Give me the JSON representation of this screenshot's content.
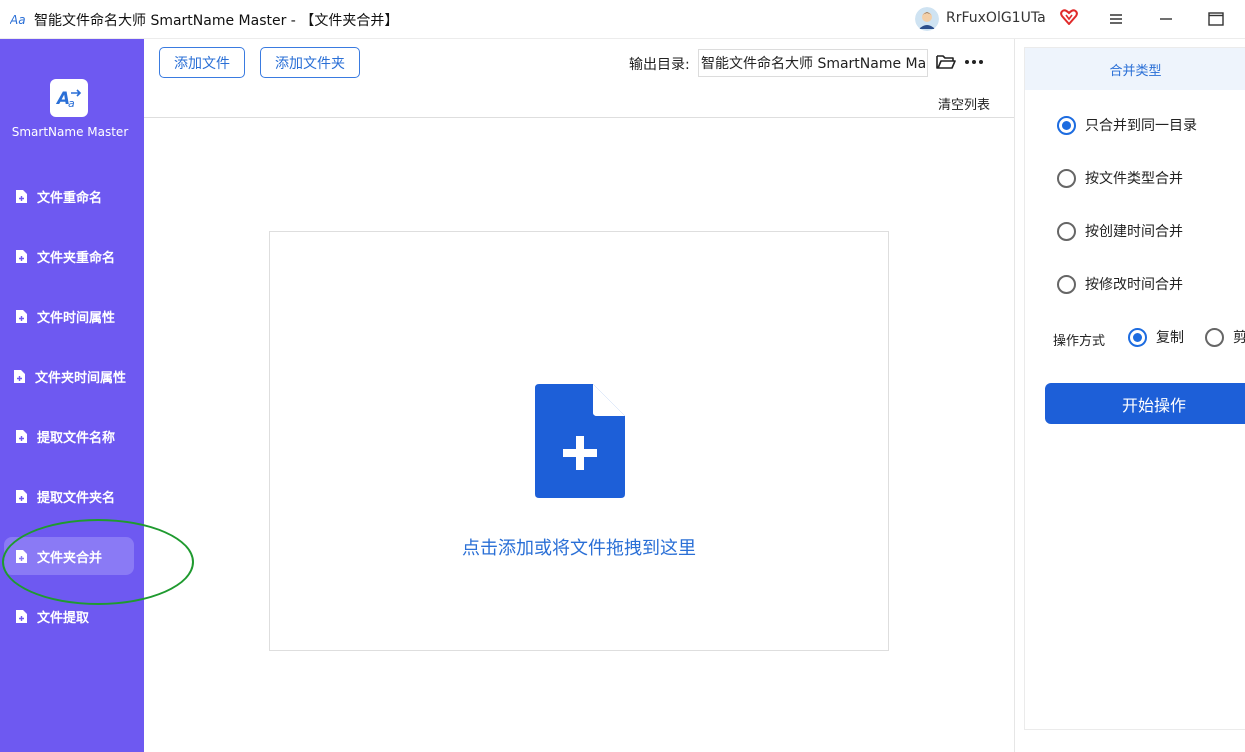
{
  "titlebar": {
    "title": "智能文件命名大师 SmartName Master - 【文件夹合并】",
    "user_name": "RrFuxOlG1UTa"
  },
  "sidebar": {
    "logo_text": "SmartName Master",
    "items": [
      {
        "label": "文件重命名"
      },
      {
        "label": "文件夹重命名"
      },
      {
        "label": "文件时间属性"
      },
      {
        "label": "文件夹时间属性"
      },
      {
        "label": "提取文件名称"
      },
      {
        "label": "提取文件夹名"
      },
      {
        "label": "文件夹合并"
      },
      {
        "label": "文件提取"
      }
    ],
    "active_index": 6
  },
  "toolbar": {
    "add_file_label": "添加文件",
    "add_folder_label": "添加文件夹",
    "output_label": "输出目录:",
    "output_value": "智能文件命名大师 SmartName Master",
    "clear_list_label": "清空列表"
  },
  "dropzone": {
    "hint": "点击添加或将文件拖拽到这里"
  },
  "right_panel": {
    "header": "合并类型",
    "merge_options": [
      {
        "label": "只合并到同一目录",
        "selected": true
      },
      {
        "label": "按文件类型合并",
        "selected": false
      },
      {
        "label": "按创建时间合并",
        "selected": false
      },
      {
        "label": "按修改时间合并",
        "selected": false
      }
    ],
    "operation_label": "操作方式",
    "operation_options": [
      {
        "label": "复制",
        "selected": true
      },
      {
        "label": "剪",
        "selected": false
      }
    ],
    "start_label": "开始操作"
  },
  "colors": {
    "sidebar_bg": "#6e59f1",
    "accent_blue": "#1d5fd8",
    "highlight_green": "#1f9a2f"
  },
  "icons": [
    "app-logo-icon",
    "user-avatar",
    "vip-heart-icon",
    "menu-icon",
    "minimize-icon",
    "maximize-icon",
    "file-icon",
    "folder-open-icon",
    "more-icon",
    "add-file-icon"
  ]
}
